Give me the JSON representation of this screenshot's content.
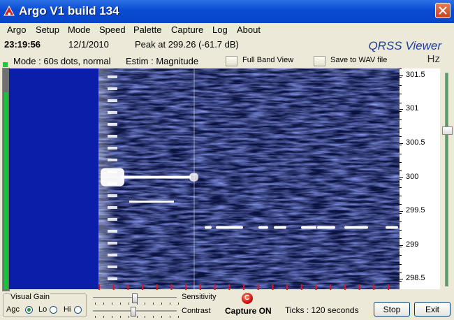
{
  "window": {
    "title": "Argo V1 build 134"
  },
  "menu": [
    "Argo",
    "Setup",
    "Mode",
    "Speed",
    "Palette",
    "Capture",
    "Log",
    "About"
  ],
  "status": {
    "time": "23:19:56",
    "date": "12/1/2010",
    "peak": "Peak at 299.26 (-61.7 dB)",
    "mode": "Mode : 60s dots, normal",
    "estim": "Estim : Magnitude",
    "full_band_label": "Full Band View",
    "save_wav_label": "Save to WAV file"
  },
  "branding": {
    "logo_text": "QRSS Viewer",
    "unit": "Hz"
  },
  "frequency_axis": {
    "labels": [
      "301.5",
      "301",
      "300.5",
      "300",
      "299.5",
      "299",
      "298.5"
    ],
    "values": [
      301.5,
      301.0,
      300.5,
      300.0,
      299.5,
      299.0,
      298.5
    ],
    "range": [
      301.6,
      298.35
    ]
  },
  "signals": {
    "peak_frequency": 299.26
  },
  "controls": {
    "visual_gain_title": "Visual Gain",
    "gain_options": [
      "Agc",
      "Lo",
      "Hi"
    ],
    "gain_selected": "Agc",
    "sensitivity_label": "Sensitivity",
    "contrast_label": "Contrast",
    "capture_label": "Capture ON",
    "capture_icon": "C",
    "ticks_label": "Ticks   : 120 seconds",
    "stop_label": "Stop",
    "exit_label": "Exit",
    "sensitivity_value": 0.49,
    "contrast_value": 0.47
  },
  "colors": {
    "titlebar": "#0a4ad2",
    "waterfall_bg": "#0a1240",
    "signal": "#ffffff",
    "agc_panel": "#0a1eaa",
    "meter": "#19c43a",
    "led": "#d01010"
  }
}
